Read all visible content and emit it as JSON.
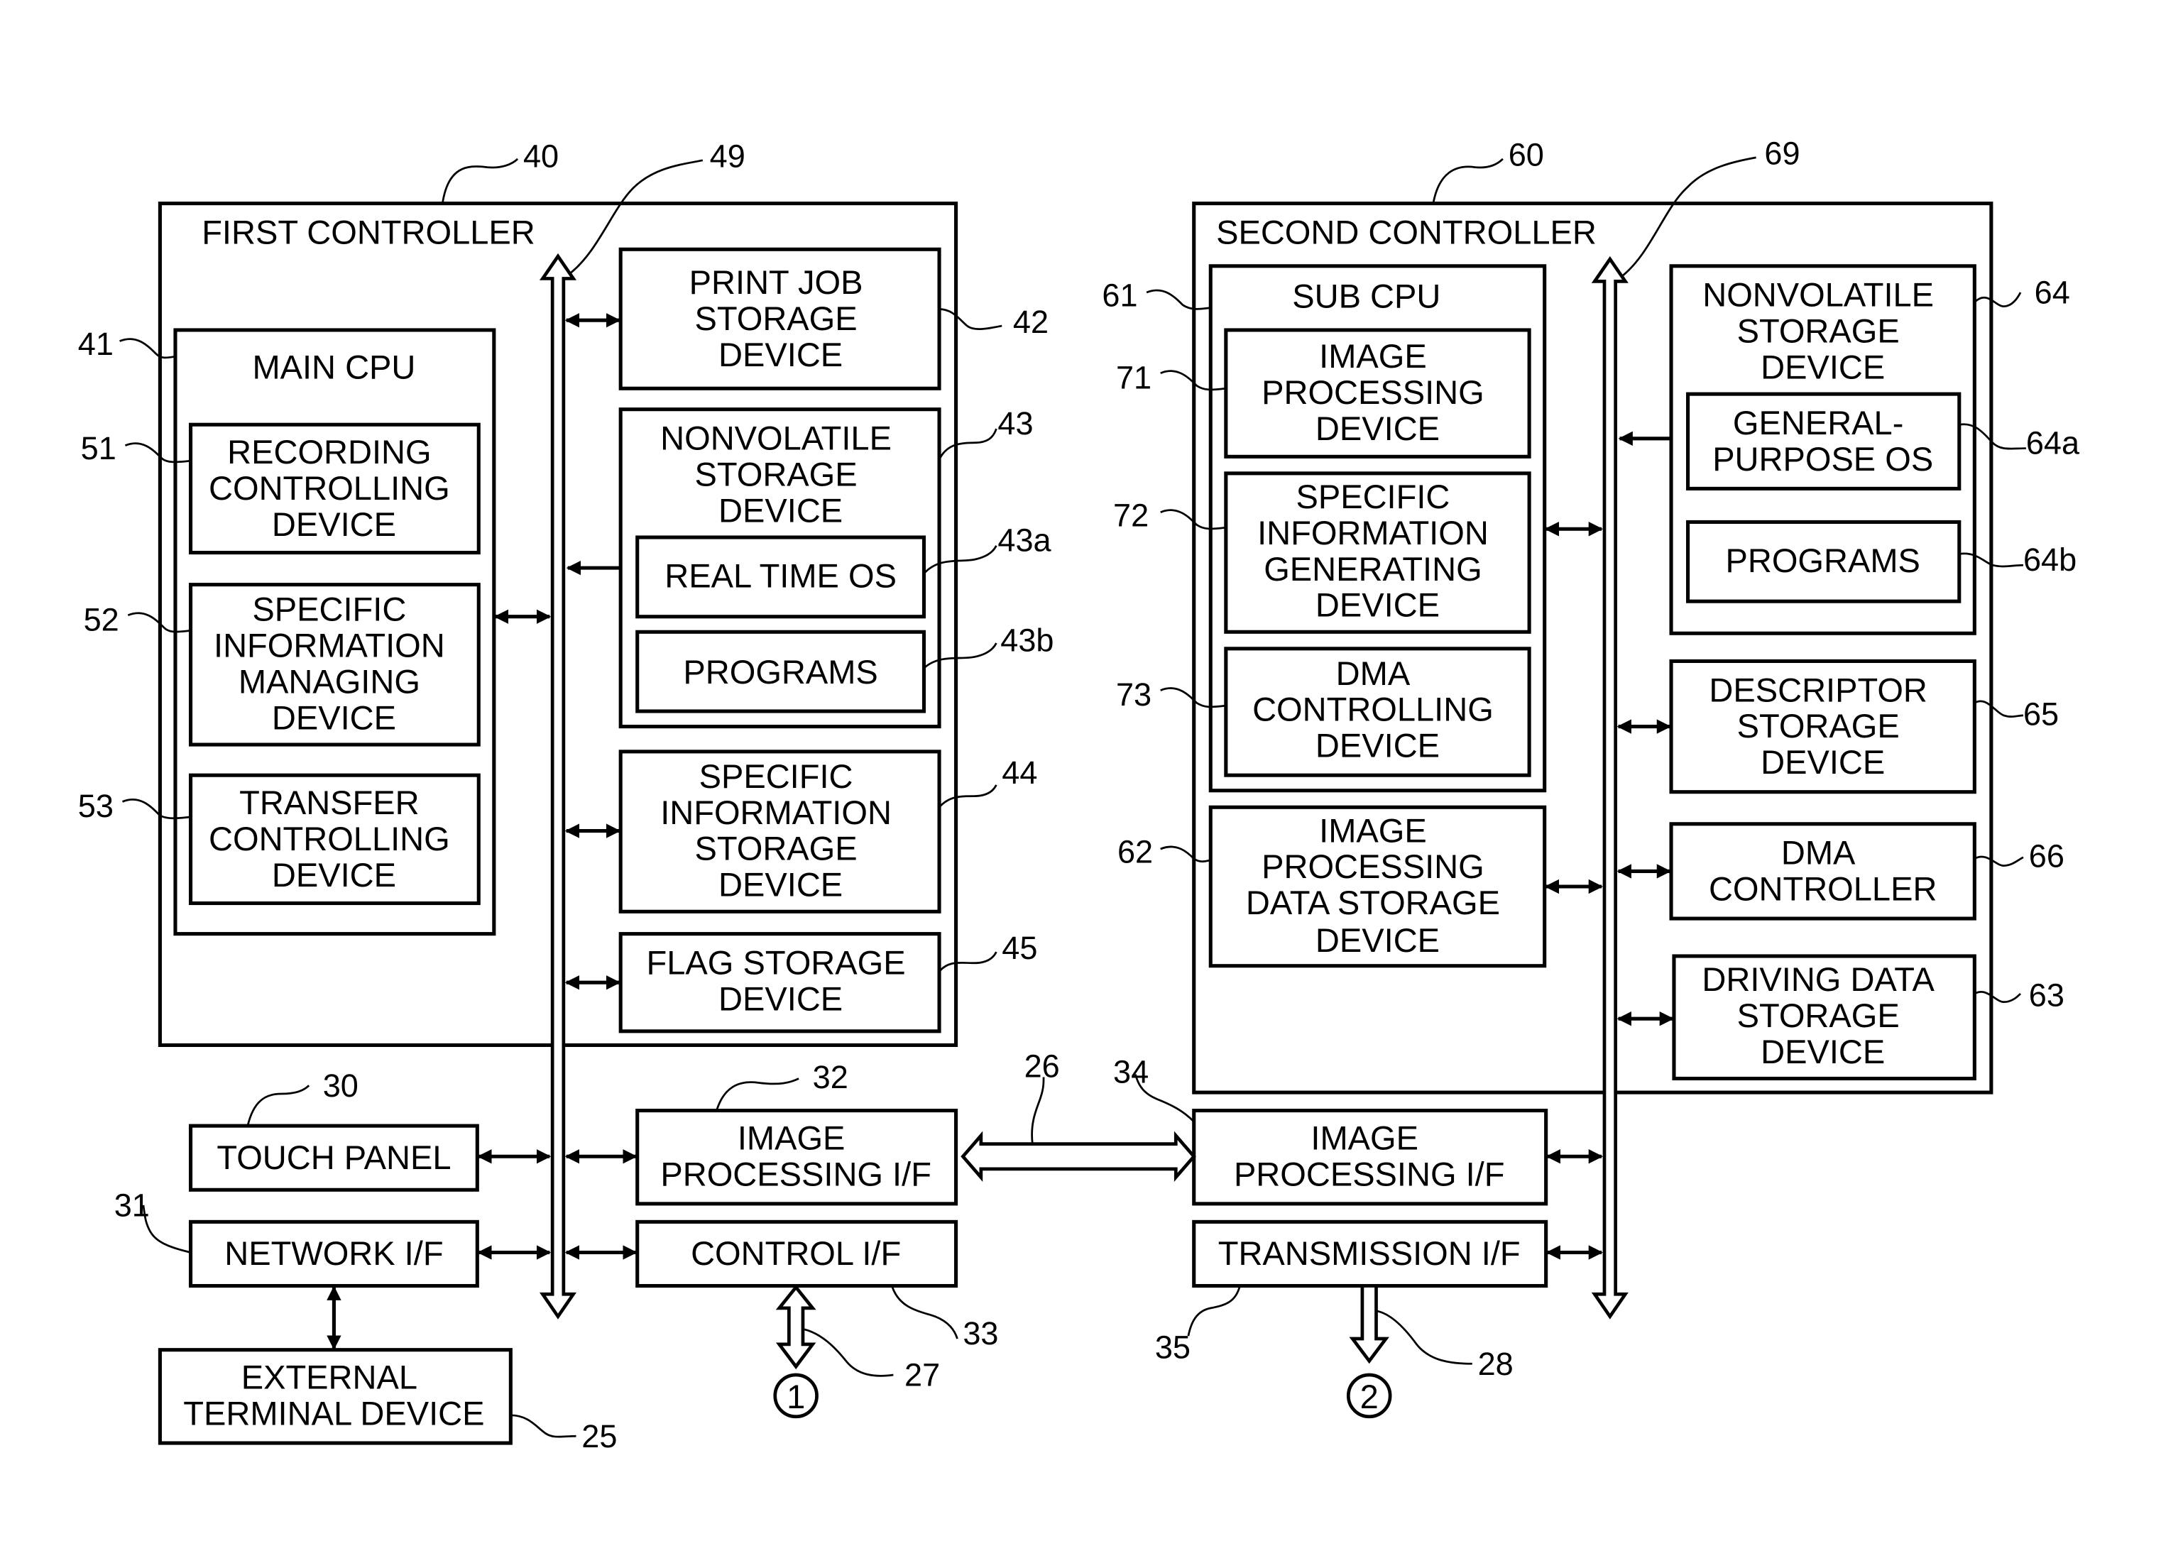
{
  "diagram": {
    "first_controller": {
      "title": "FIRST CONTROLLER",
      "ref": "40",
      "bus_ref": "49",
      "main_cpu": {
        "title": "MAIN CPU",
        "ref": "41",
        "blocks": [
          {
            "ref": "51",
            "lines": [
              "RECORDING",
              "CONTROLLING",
              "DEVICE"
            ]
          },
          {
            "ref": "52",
            "lines": [
              "SPECIFIC",
              "INFORMATION",
              "MANAGING",
              "DEVICE"
            ]
          },
          {
            "ref": "53",
            "lines": [
              "TRANSFER",
              "CONTROLLING",
              "DEVICE"
            ]
          }
        ]
      },
      "print_job": {
        "ref": "42",
        "lines": [
          "PRINT JOB",
          "STORAGE",
          "DEVICE"
        ]
      },
      "nonvolatile": {
        "ref": "43",
        "lines": [
          "NONVOLATILE",
          "STORAGE",
          "DEVICE"
        ],
        "os": {
          "ref": "43a",
          "label": "REAL TIME OS"
        },
        "programs": {
          "ref": "43b",
          "label": "PROGRAMS"
        }
      },
      "specific_storage": {
        "ref": "44",
        "lines": [
          "SPECIFIC",
          "INFORMATION",
          "STORAGE",
          "DEVICE"
        ]
      },
      "flag_storage": {
        "ref": "45",
        "lines": [
          "FLAG STORAGE",
          "DEVICE"
        ]
      }
    },
    "second_controller": {
      "title": "SECOND CONTROLLER",
      "ref": "60",
      "bus_ref": "69",
      "sub_cpu": {
        "title": "SUB CPU",
        "ref": "61",
        "blocks": [
          {
            "ref": "71",
            "lines": [
              "IMAGE",
              "PROCESSING",
              "DEVICE"
            ]
          },
          {
            "ref": "72",
            "lines": [
              "SPECIFIC",
              "INFORMATION",
              "GENERATING",
              "DEVICE"
            ]
          },
          {
            "ref": "73",
            "lines": [
              "DMA",
              "CONTROLLING",
              "DEVICE"
            ]
          }
        ]
      },
      "image_data_storage": {
        "ref": "62",
        "lines": [
          "IMAGE",
          "PROCESSING",
          "DATA STORAGE",
          "DEVICE"
        ]
      },
      "nonvolatile": {
        "ref": "64",
        "lines": [
          "NONVOLATILE",
          "STORAGE",
          "DEVICE"
        ],
        "os": {
          "ref": "64a",
          "lines": [
            "GENERAL-",
            "PURPOSE OS"
          ]
        },
        "programs": {
          "ref": "64b",
          "label": "PROGRAMS"
        }
      },
      "descriptor": {
        "ref": "65",
        "lines": [
          "DESCRIPTOR",
          "STORAGE",
          "DEVICE"
        ]
      },
      "dma_controller": {
        "ref": "66",
        "lines": [
          "DMA",
          "CONTROLLER"
        ]
      },
      "driving_data": {
        "ref": "63",
        "lines": [
          "DRIVING DATA",
          "STORAGE",
          "DEVICE"
        ]
      }
    },
    "peripherals": {
      "touch_panel": {
        "ref": "30",
        "label": "TOUCH PANEL"
      },
      "network_if": {
        "ref": "31",
        "label": "NETWORK I/F"
      },
      "external_terminal": {
        "ref": "25",
        "lines": [
          "EXTERNAL",
          "TERMINAL DEVICE"
        ]
      },
      "image_if_1": {
        "ref": "32",
        "lines": [
          "IMAGE",
          "PROCESSING I/F"
        ]
      },
      "control_if": {
        "ref": "33",
        "label": "CONTROL I/F"
      },
      "image_if_2": {
        "ref": "34",
        "lines": [
          "IMAGE",
          "PROCESSING I/F"
        ]
      },
      "transmission_if": {
        "ref": "35",
        "label": "TRANSMISSION I/F"
      },
      "link_ref": "26",
      "out1": {
        "ref": "27",
        "connector": "1"
      },
      "out2": {
        "ref": "28",
        "connector": "2"
      }
    }
  }
}
